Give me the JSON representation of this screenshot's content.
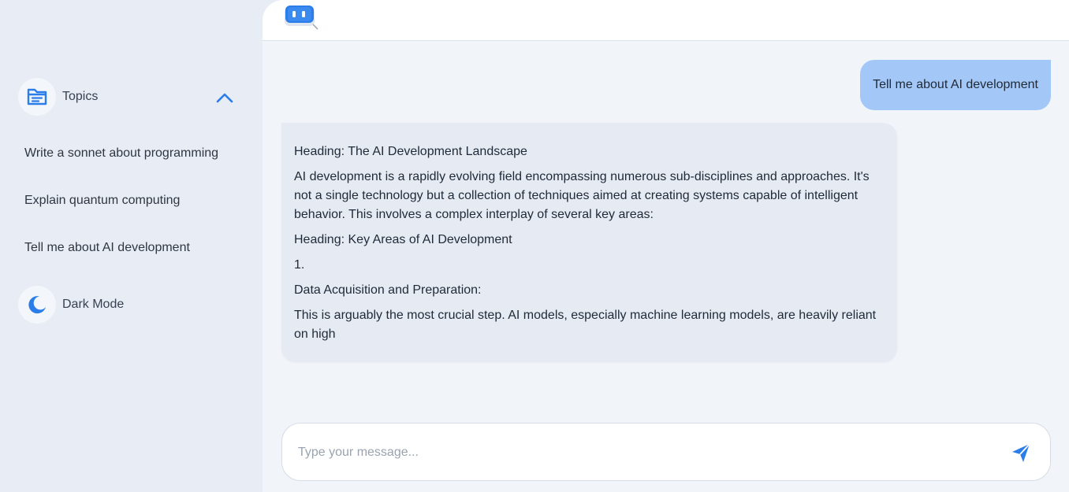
{
  "sidebar": {
    "topics_label": "Topics",
    "topics_icon": "folder-icon",
    "items": [
      {
        "label": "Write a sonnet about programming"
      },
      {
        "label": "Explain quantum computing"
      },
      {
        "label": "Tell me about AI development"
      }
    ],
    "dark_mode_label": "Dark Mode",
    "dark_mode_icon": "moon-icon"
  },
  "header": {
    "logo_icon": "robot-chat-icon"
  },
  "chat": {
    "user_message": "Tell me about AI development",
    "bot_paragraphs": [
      "Heading: The AI Development Landscape",
      "AI development is a rapidly evolving field encompassing numerous sub-disciplines and approaches. It's not a single technology but a collection of techniques aimed at creating systems capable of intelligent behavior. This involves a complex interplay of several key areas:",
      "Heading: Key Areas of AI Development",
      "1.",
      "Data Acquisition and Preparation:",
      "This is arguably the most crucial step. AI models, especially machine learning models, are heavily reliant on high"
    ]
  },
  "composer": {
    "placeholder": "Type your message...",
    "value": "",
    "send_icon": "send-icon"
  },
  "colors": {
    "accent": "#2b7de9",
    "user_bubble": "#a3c8f8",
    "bot_bubble": "#e6ebf3",
    "sidebar_bg": "#e8edf5"
  }
}
